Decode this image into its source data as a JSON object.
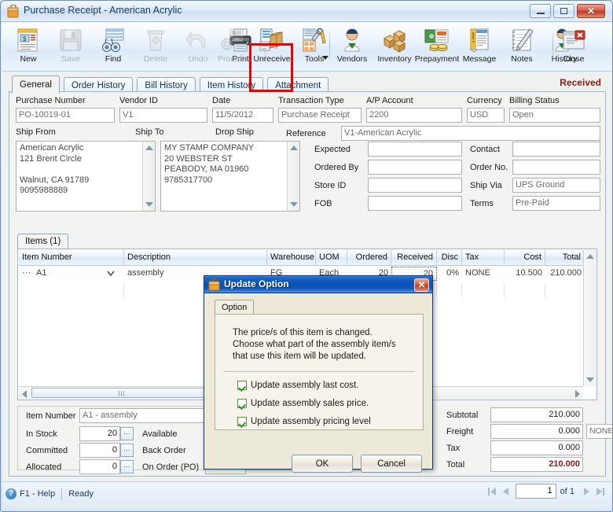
{
  "window": {
    "title": "Purchase Receipt - American Acrylic",
    "icon": "purchase-receipt-icon",
    "minimize": "─",
    "maximize": "□",
    "close": "✕"
  },
  "toolbar": {
    "items": [
      {
        "label": "New",
        "icon": "new-document-icon",
        "disabled": false
      },
      {
        "label": "Save",
        "icon": "save-floppy-icon",
        "disabled": true
      },
      {
        "label": "Find",
        "icon": "find-binoculars-icon",
        "disabled": false
      },
      {
        "label": "Delete",
        "icon": "delete-trash-icon",
        "disabled": true
      },
      {
        "label": "Undo",
        "icon": "undo-arrow-icon",
        "disabled": true
      },
      {
        "label": "Print",
        "icon": "print-printer-icon",
        "disabled": false
      },
      {
        "label": "Process",
        "icon": "process-gear-icon",
        "disabled": true
      },
      {
        "label": "Unreceive",
        "icon": "unreceive-box-icon",
        "disabled": false
      },
      {
        "label": "Tools",
        "icon": "tools-wrench-icon",
        "disabled": false
      },
      {
        "label": "Vendors",
        "icon": "vendors-person-icon",
        "disabled": false
      },
      {
        "label": "Inventory",
        "icon": "inventory-boxes-icon",
        "disabled": false
      },
      {
        "label": "Prepayment",
        "icon": "prepayment-coins-icon",
        "disabled": false
      },
      {
        "label": "Message",
        "icon": "message-note-icon",
        "disabled": false
      },
      {
        "label": "Notes",
        "icon": "notes-pencil-icon",
        "disabled": false
      },
      {
        "label": "History",
        "icon": "history-hourglass-icon",
        "disabled": false
      },
      {
        "label": "Close",
        "icon": "close-window-icon",
        "disabled": false
      }
    ],
    "highlight": "Unreceive"
  },
  "tabs": [
    {
      "label": "General",
      "active": true
    },
    {
      "label": "Order History",
      "active": false
    },
    {
      "label": "Bill History",
      "active": false
    },
    {
      "label": "Item History",
      "active": false
    },
    {
      "label": "Attachment",
      "active": false
    }
  ],
  "status_label": "Received",
  "status_color": "#8b1a16",
  "general": {
    "fields": [
      {
        "label": "Purchase Number",
        "value": "PO-10019-01"
      },
      {
        "label": "Vendor ID",
        "value": "V1"
      },
      {
        "label": "Date",
        "value": "11/5/2012"
      },
      {
        "label": "Transaction Type",
        "value": "Purchase Receipt"
      },
      {
        "label": "A/P Account",
        "value": "2200"
      },
      {
        "label": "Currency",
        "value": "USD"
      },
      {
        "label": "Billing Status",
        "value": "Open"
      }
    ],
    "ship_from_label": "Ship From",
    "ship_to_label": "Ship To",
    "drop_ship_label": "Drop Ship",
    "ship_from": "American Acrylic\n121 Brent Circle\n\nWalnut, CA 91789\n9095988889",
    "ship_to": "MY STAMP COMPANY\n20 WEBSTER ST\nPEABODY, MA 01960\n9785317700",
    "reference_label": "Reference",
    "reference_value": "V1-American Acrylic",
    "left_pairs": [
      {
        "label": "Expected",
        "value": ""
      },
      {
        "label": "Ordered By",
        "value": ""
      },
      {
        "label": "Store ID",
        "value": ""
      },
      {
        "label": "FOB",
        "value": ""
      }
    ],
    "right_pairs": [
      {
        "label": "Contact",
        "value": ""
      },
      {
        "label": "Order No.",
        "value": ""
      },
      {
        "label": "Ship Via",
        "value": "UPS Ground"
      },
      {
        "label": "Terms",
        "value": "Pre-Paid"
      }
    ]
  },
  "items": {
    "tab_label": "Items (1)",
    "columns": [
      "Item Number",
      "Description",
      "Warehouse",
      "UOM",
      "Ordered",
      "Received",
      "Disc",
      "Tax",
      "Cost",
      "Total"
    ],
    "rows": [
      {
        "item_number": "A1",
        "dots": "···",
        "description": "assembly",
        "warehouse": "FG",
        "uom": "Each",
        "ordered": "20",
        "received": "20",
        "disc": "0%",
        "tax": "NONE",
        "cost": "10.500",
        "total": "210.000"
      }
    ]
  },
  "detail": {
    "item_number_label": "Item Number",
    "item_number_value": "A1 - assembly",
    "left": [
      {
        "label": "In Stock",
        "value": "20"
      },
      {
        "label": "Committed",
        "value": "0"
      },
      {
        "label": "Allocated",
        "value": "0"
      }
    ],
    "right": [
      {
        "label": "Available",
        "value": ""
      },
      {
        "label": "Back Order",
        "value": ""
      },
      {
        "label": "On Order (PO)",
        "value": ""
      }
    ]
  },
  "totals": {
    "rows": [
      {
        "label": "Subtotal",
        "value": "210.000",
        "extra": ""
      },
      {
        "label": "Freight",
        "value": "0.000",
        "extra": "NONE"
      },
      {
        "label": "Tax",
        "value": "0.000",
        "extra": ""
      },
      {
        "label": "Total",
        "value": "210.000",
        "extra": ""
      }
    ],
    "total_color": "#8b1a16"
  },
  "statusbar": {
    "help_icon": "help-question-icon",
    "help_text": "F1 - Help",
    "ready_text": "Ready",
    "page": "1",
    "of_text": "of 1"
  },
  "modal": {
    "title": "Update Option",
    "icon": "update-option-icon",
    "close": "✕",
    "tab_label": "Option",
    "message": "The price/s of this item is changed.\nChoose what part of the assembly item/s\nthat use this item will be updated.",
    "checkboxes": [
      {
        "label": "Update assembly last cost.",
        "checked": true
      },
      {
        "label": "Update assembly sales price.",
        "checked": true
      },
      {
        "label": "Update assembly pricing level",
        "checked": true
      }
    ],
    "ok_label": "OK",
    "cancel_label": "Cancel"
  }
}
